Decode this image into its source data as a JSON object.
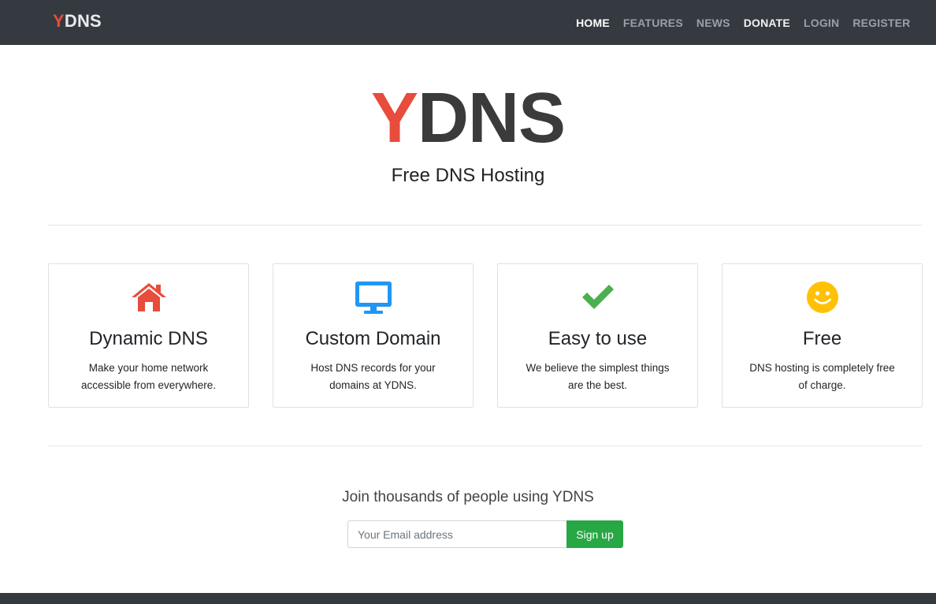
{
  "navbar": {
    "brand_y": "Y",
    "brand_rest": "DNS",
    "links": [
      {
        "label": "HOME",
        "state": "active"
      },
      {
        "label": "FEATURES",
        "state": "muted"
      },
      {
        "label": "NEWS",
        "state": "muted"
      },
      {
        "label": "DONATE",
        "state": "bright"
      },
      {
        "label": "LOGIN",
        "state": "muted"
      },
      {
        "label": "REGISTER",
        "state": "muted"
      }
    ]
  },
  "hero": {
    "logo_y": "Y",
    "logo_rest": "DNS",
    "subtitle": "Free DNS Hosting"
  },
  "features": [
    {
      "icon": "home-icon",
      "color": "#e74c3c",
      "title": "Dynamic DNS",
      "text": "Make your home network accessible from everywhere."
    },
    {
      "icon": "monitor-icon",
      "color": "#2196f3",
      "title": "Custom Domain",
      "text": "Host DNS records for your domains at YDNS."
    },
    {
      "icon": "check-icon",
      "color": "#4caf50",
      "title": "Easy to use",
      "text": "We believe the simplest things are the best."
    },
    {
      "icon": "smiley-icon",
      "color": "#ffc107",
      "title": "Free",
      "text": "DNS hosting is completely free of charge."
    }
  ],
  "signup": {
    "heading": "Join thousands of people using YDNS",
    "email_placeholder": "Your Email address",
    "email_value": "",
    "button_label": "Sign up"
  },
  "colors": {
    "navbar_bg": "#343a40",
    "accent_red": "#e74c3c",
    "button_green": "#28a745"
  }
}
